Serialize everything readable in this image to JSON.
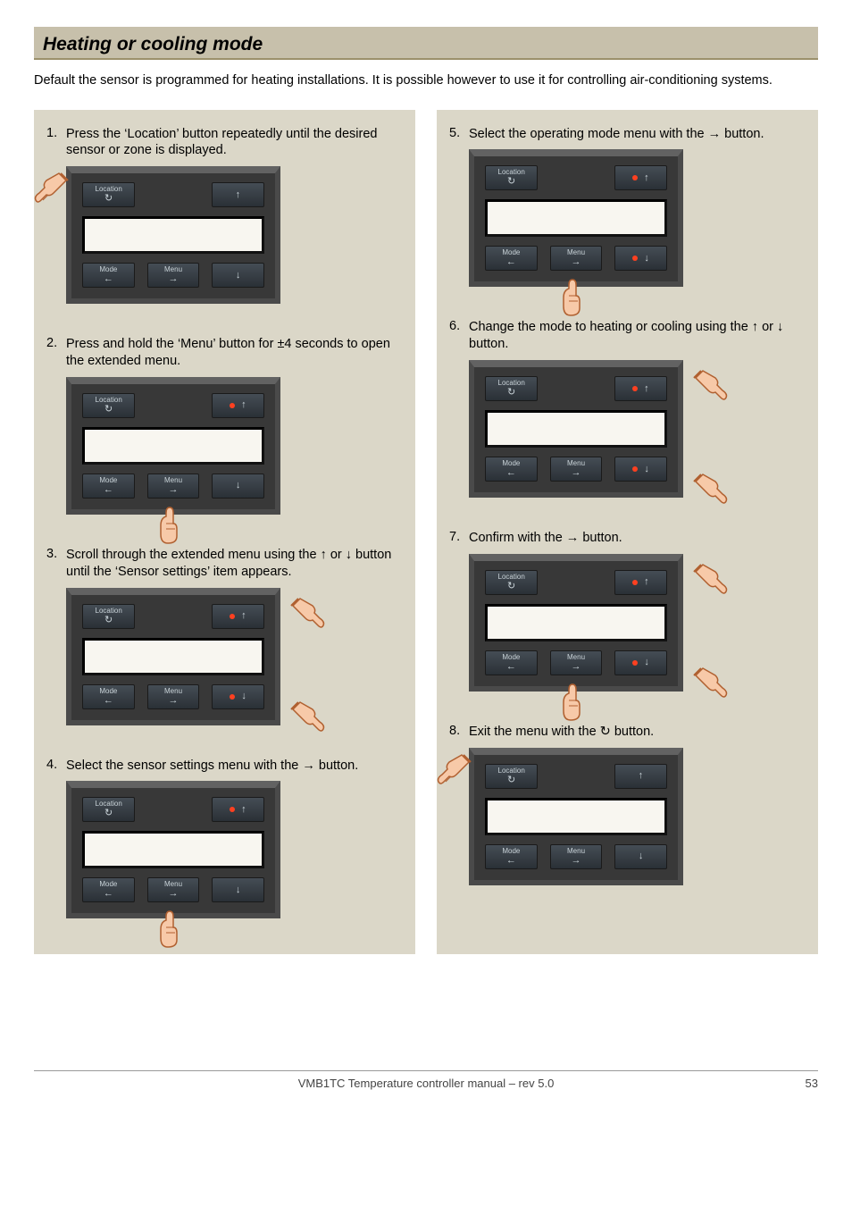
{
  "title": "Heating or cooling mode",
  "intro": "Default the sensor is programmed for heating installations. It is possible however to use it for controlling air-conditioning systems.",
  "buttons": {
    "location": "Location",
    "location_sym": "↻",
    "mode": "Mode",
    "mode_sym": "←",
    "menu": "Menu",
    "menu_sym": "→",
    "up": "↑",
    "down": "↓"
  },
  "steps_left": [
    {
      "n": "1.",
      "text": "Press the ‘Location’ button repeatedly until the desired sensor or zone is displayed."
    },
    {
      "n": "2.",
      "text": "Press and hold the ‘Menu’ button for ±4 seconds to open the extended menu."
    },
    {
      "n": "3.",
      "text": "Scroll through the extended menu using the ↑ or ↓ button until the ‘Sensor settings’ item appears."
    },
    {
      "n": "4.",
      "text": "Select the sensor settings menu with the → button."
    }
  ],
  "steps_right": [
    {
      "n": "5.",
      "text": "Select the operating mode menu with the → button."
    },
    {
      "n": "6.",
      "text": "Change the mode to heating or cooling using the ↑ or ↓ button."
    },
    {
      "n": "7.",
      "text": "Confirm with the → button."
    },
    {
      "n": "8.",
      "text": "Exit the menu with the ↻ button."
    }
  ],
  "footer": {
    "center": "VMB1TC Temperature controller manual – rev 5.0",
    "page": "53"
  }
}
